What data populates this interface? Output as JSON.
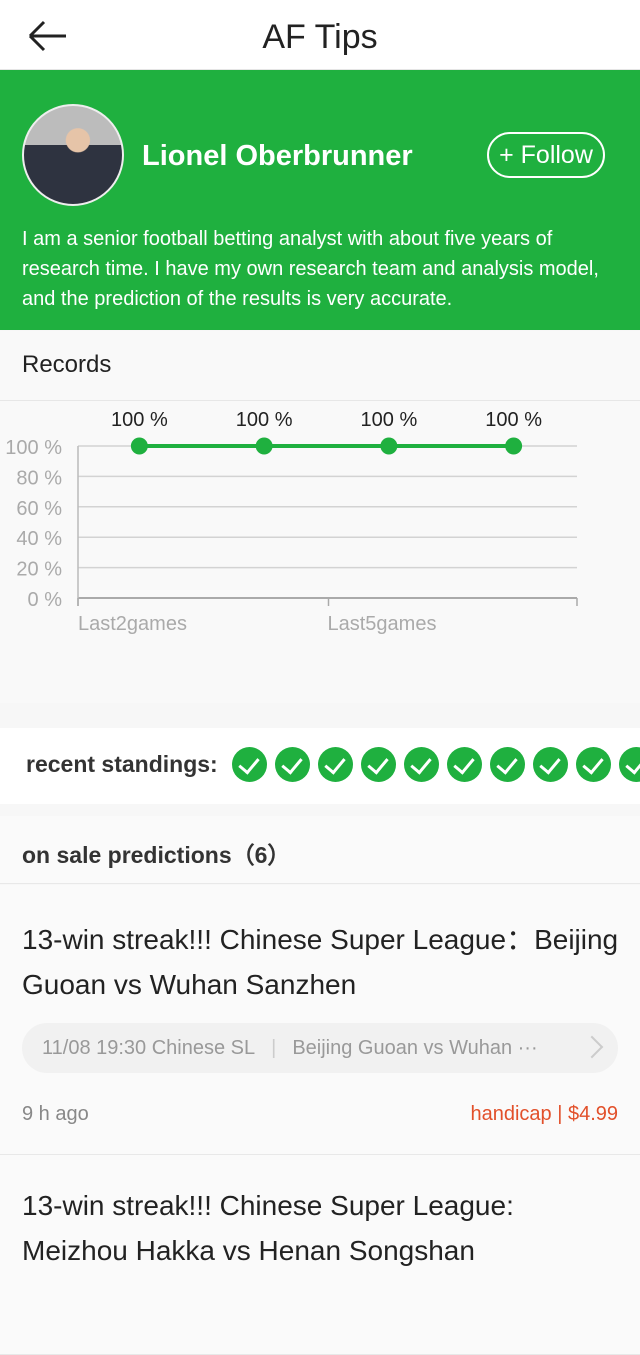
{
  "header": {
    "title": "AF Tips",
    "back_icon": "arrow-left-icon"
  },
  "profile": {
    "name": "Lionel Oberbrunner",
    "follow_label": "+ Follow",
    "bio": "I am a senior football betting analyst with about five years of research time. I have my own research team and analysis model, and the prediction of the results is very accurate."
  },
  "records": {
    "title": "Records"
  },
  "chart_data": {
    "type": "line",
    "values": [
      100,
      100,
      100,
      100
    ],
    "data_labels": [
      "100 %",
      "100 %",
      "100 %",
      "100 %"
    ],
    "x_tick_labels": [
      "Last2games",
      "Last5games"
    ],
    "y_ticks": [
      "0 %",
      "20 %",
      "40 %",
      "60 %",
      "80 %",
      "100 %"
    ],
    "ylim": [
      0,
      100
    ],
    "grid": true,
    "color": "#1fb03f"
  },
  "standings": {
    "label": "recent standings:",
    "results": [
      "win",
      "win",
      "win",
      "win",
      "win",
      "win",
      "win",
      "win",
      "win",
      "win"
    ]
  },
  "on_sale": {
    "label": "on sale predictions（6）"
  },
  "predictions": [
    {
      "title": "13-win streak!!! Chinese Super League：Beijing Guoan vs Wuhan Sanzhen",
      "match_time": "11/08 19:30 Chinese SL",
      "match": "Beijing Guoan vs Wuhan ···",
      "ago": "9 h ago",
      "price": "handicap | $4.99"
    },
    {
      "title": "13-win streak!!! Chinese Super League: Meizhou Hakka vs Henan Songshan"
    }
  ],
  "colors": {
    "brand": "#1fb03f",
    "price": "#e2502a"
  }
}
